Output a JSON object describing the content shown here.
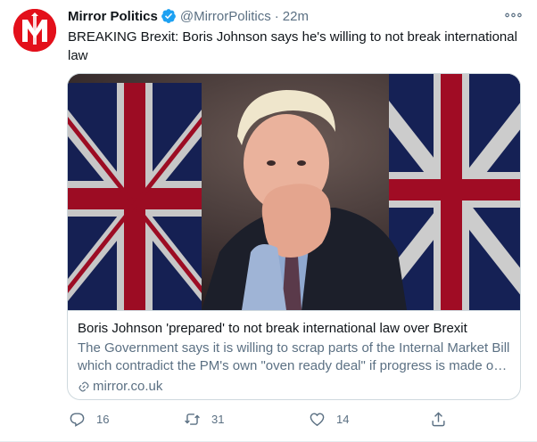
{
  "tweet": {
    "author_name": "Mirror Politics",
    "handle": "@MirrorPolitics",
    "separator": "·",
    "time": "22m",
    "text": "BREAKING Brexit: Boris Johnson says he's willing to not break international law",
    "avatar_letter": "M",
    "verified": true
  },
  "card": {
    "title": "Boris Johnson 'prepared' to not break international law over Brexit",
    "description": "The Government says it is willing to scrap parts of the Internal Market Bill which contradict the PM's own \"oven ready deal\" if progress is made on trade talks",
    "domain": "mirror.co.uk",
    "image_icon": "news-photo"
  },
  "actions": {
    "replies": "16",
    "retweets": "31",
    "likes": "14",
    "reply_icon": "reply-icon",
    "retweet_icon": "retweet-icon",
    "like_icon": "heart-icon",
    "share_icon": "share-icon"
  },
  "colors": {
    "brand": "#e3101b",
    "verified": "#1da1f2",
    "secondary_text": "#5b7083",
    "border": "#cfd9de"
  }
}
